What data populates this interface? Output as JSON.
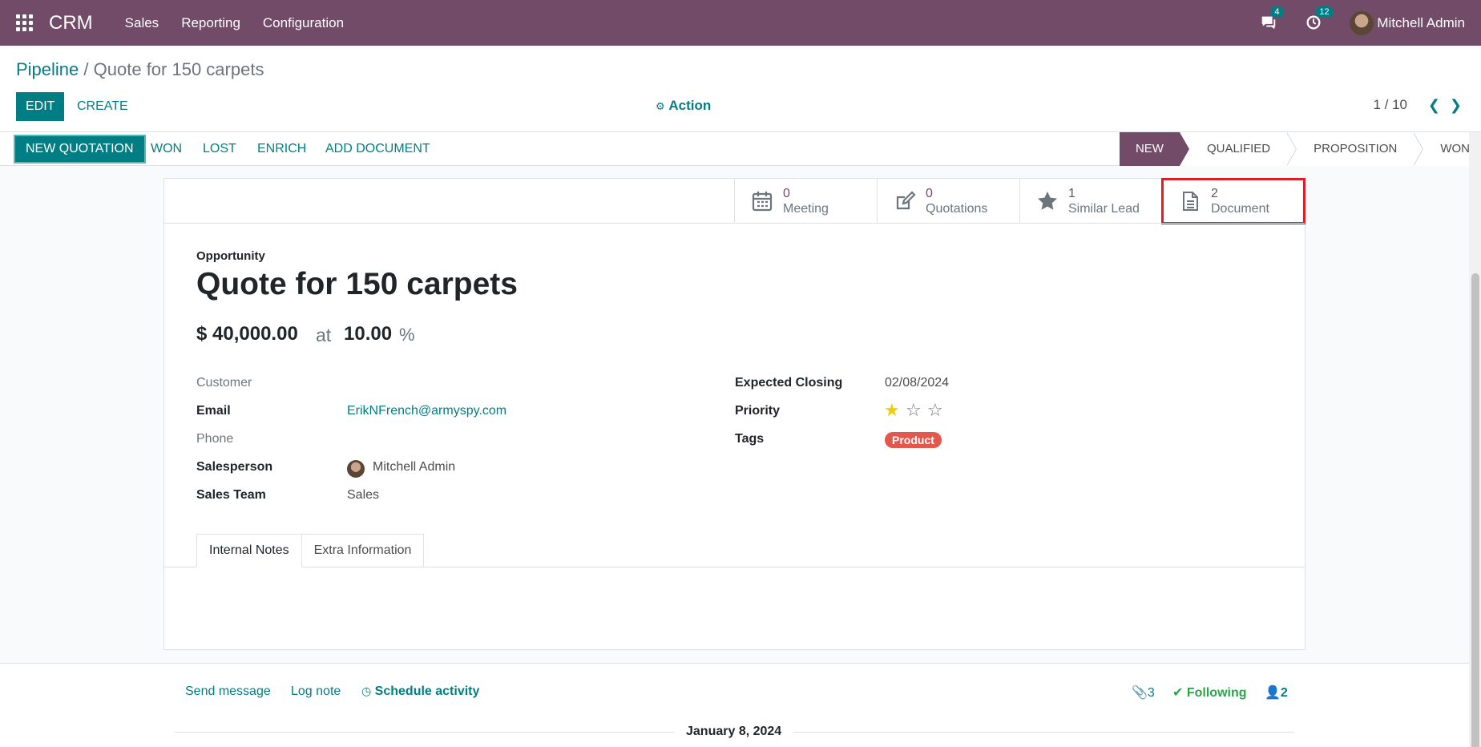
{
  "navbar": {
    "app_name": "CRM",
    "menus": [
      "Sales",
      "Reporting",
      "Configuration"
    ],
    "messages_badge": "4",
    "activities_badge": "12",
    "user_name": "Mitchell Admin"
  },
  "control_panel": {
    "breadcrumb_parent": "Pipeline",
    "breadcrumb_sep": "/",
    "breadcrumb_current": "Quote for 150 carpets",
    "edit_label": "EDIT",
    "create_label": "CREATE",
    "action_label": "Action",
    "pager": "1 / 10"
  },
  "statusbar": {
    "new_quotation": "NEW QUOTATION",
    "won": "WON",
    "lost": "LOST",
    "enrich": "ENRICH",
    "add_document": "ADD DOCUMENT",
    "stages": [
      "NEW",
      "QUALIFIED",
      "PROPOSITION",
      "WON"
    ]
  },
  "smart_buttons": [
    {
      "count": "0",
      "label": "Meeting",
      "icon": "calendar-icon"
    },
    {
      "count": "0",
      "label": "Quotations",
      "icon": "edit-icon"
    },
    {
      "count": "1",
      "label": "Similar Lead",
      "icon": "star-icon"
    },
    {
      "count": "2",
      "label": "Document",
      "icon": "document-icon"
    }
  ],
  "record": {
    "type_label": "Opportunity",
    "title": "Quote for 150 carpets",
    "revenue": "$ 40,000.00",
    "at": "at",
    "probability": "10.00",
    "percent": "%"
  },
  "fields_left": {
    "customer_label": "Customer",
    "email_label": "Email",
    "email_value": "ErikNFrench@armyspy.com",
    "phone_label": "Phone",
    "salesperson_label": "Salesperson",
    "salesperson_value": "Mitchell Admin",
    "team_label": "Sales Team",
    "team_value": "Sales"
  },
  "fields_right": {
    "closing_label": "Expected Closing",
    "closing_value": "02/08/2024",
    "priority_label": "Priority",
    "priority_stars": 1,
    "tags_label": "Tags",
    "tag": "Product"
  },
  "tabs": [
    "Internal Notes",
    "Extra Information"
  ],
  "chatter": {
    "send_message": "Send message",
    "log_note": "Log note",
    "schedule_activity": "Schedule activity",
    "attachments": "3",
    "following": "Following",
    "followers": "2",
    "date": "January 8, 2024"
  },
  "colors": {
    "brand": "#714b67",
    "accent": "#017e84",
    "highlight": "#dc1f26",
    "tag": "#e4574d"
  }
}
